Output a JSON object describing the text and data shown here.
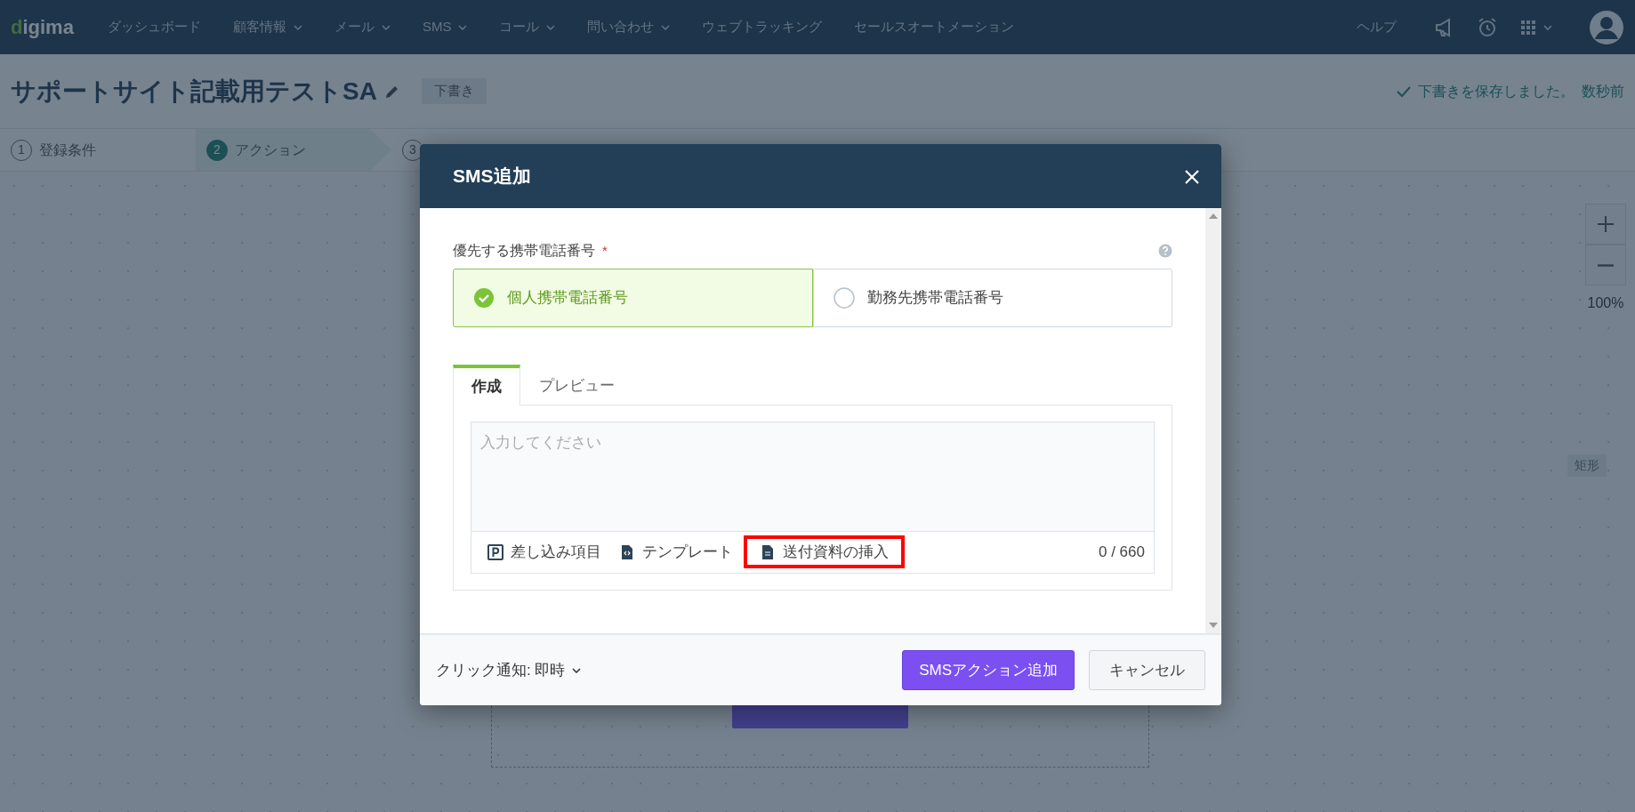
{
  "navbar": {
    "logo": "digima",
    "items": [
      {
        "label": "ダッシュボード",
        "dropdown": false
      },
      {
        "label": "顧客情報",
        "dropdown": true
      },
      {
        "label": "メール",
        "dropdown": true
      },
      {
        "label": "SMS",
        "dropdown": true
      },
      {
        "label": "コール",
        "dropdown": true
      },
      {
        "label": "問い合わせ",
        "dropdown": true
      },
      {
        "label": "ウェブトラッキング",
        "dropdown": false
      },
      {
        "label": "セールスオートメーション",
        "dropdown": false
      }
    ],
    "help": "ヘルプ"
  },
  "header": {
    "title": "サポートサイト記載用テストSA",
    "status": "下書き",
    "save_message": "下書きを保存しました。",
    "save_time": "数秒前"
  },
  "steps": [
    {
      "number": "1",
      "label": "登録条件",
      "selected": false
    },
    {
      "number": "2",
      "label": "アクション",
      "selected": true
    },
    {
      "number": "3",
      "selected": false
    }
  ],
  "canvas": {
    "zoom": "100%",
    "shape_tag": "矩形"
  },
  "modal": {
    "title": "SMS追加",
    "field_label": "優先する携帯電話番号",
    "required_mark": "*",
    "options": [
      {
        "label": "個人携帯電話番号",
        "selected": true
      },
      {
        "label": "勤務先携帯電話番号",
        "selected": false
      }
    ],
    "tabs": [
      {
        "label": "作成",
        "selected": true
      },
      {
        "label": "プレビュー",
        "selected": false
      }
    ],
    "message_placeholder": "入力してください",
    "tools": [
      {
        "kind": "merge",
        "label": "差し込み項目",
        "highlighted": false
      },
      {
        "kind": "template",
        "label": "テンプレート",
        "highlighted": false
      },
      {
        "kind": "attachment",
        "label": "送付資料の挿入",
        "highlighted": true
      }
    ],
    "counter": "0 / 660",
    "notify": "クリック通知: 即時",
    "primary_button": "SMSアクション追加",
    "cancel_button": "キャンセル"
  }
}
